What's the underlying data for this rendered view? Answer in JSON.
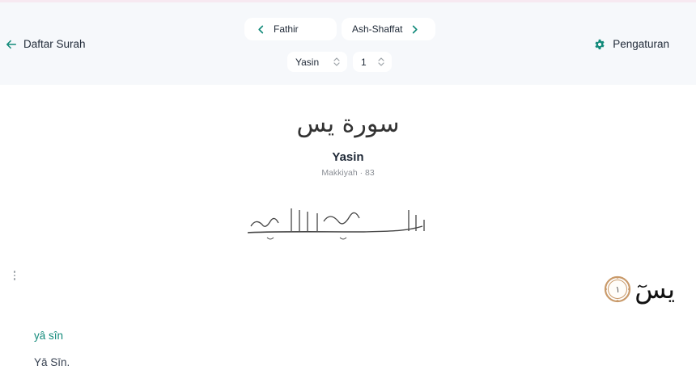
{
  "header": {
    "back_label": "Daftar Surah",
    "settings_label": "Pengaturan",
    "prev_surah": "Fathir",
    "next_surah": "Ash-Shaffat",
    "surah_select_value": "Yasin",
    "ayah_select_value": "1"
  },
  "surah": {
    "calligraphy": "سورة يس",
    "name": "Yasin",
    "meta": "Makkiyah · 83"
  },
  "ayah": {
    "arabic": "يسٓ",
    "number_arabic": "١",
    "transliteration": "yâ sîn",
    "translation": "Yā Sīn."
  },
  "colors": {
    "accent": "#128a7a",
    "header_bg": "#f6f8fb"
  }
}
